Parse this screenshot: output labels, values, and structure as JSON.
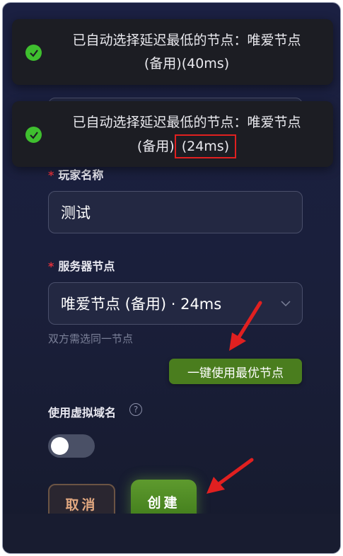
{
  "toasts": [
    {
      "line1": "已自动选择延迟最低的节点：唯爱节点",
      "line2_pre": "(备用)",
      "line2_latency": "(40ms)"
    },
    {
      "line1": "已自动选择延迟最低的节点：唯爱节点",
      "line2_pre": "(备用)",
      "line2_latency": "(24ms)"
    }
  ],
  "form": {
    "player_name": {
      "label": "玩家名称",
      "required": "*",
      "value": "测试"
    },
    "server_node": {
      "label": "服务器节点",
      "required": "*",
      "value": "唯爱节点 (备用) · 24ms"
    },
    "hint": "双方需选同一节点",
    "optimal_button": "一键使用最优节点",
    "virtual_domain": {
      "label": "使用虚拟域名",
      "help": "?",
      "enabled": false
    }
  },
  "actions": {
    "cancel": "取消",
    "create": "创建"
  },
  "colors": {
    "accent_green": "#4a7d1e",
    "highlight_red": "#e02020",
    "success": "#3fbf2f"
  }
}
